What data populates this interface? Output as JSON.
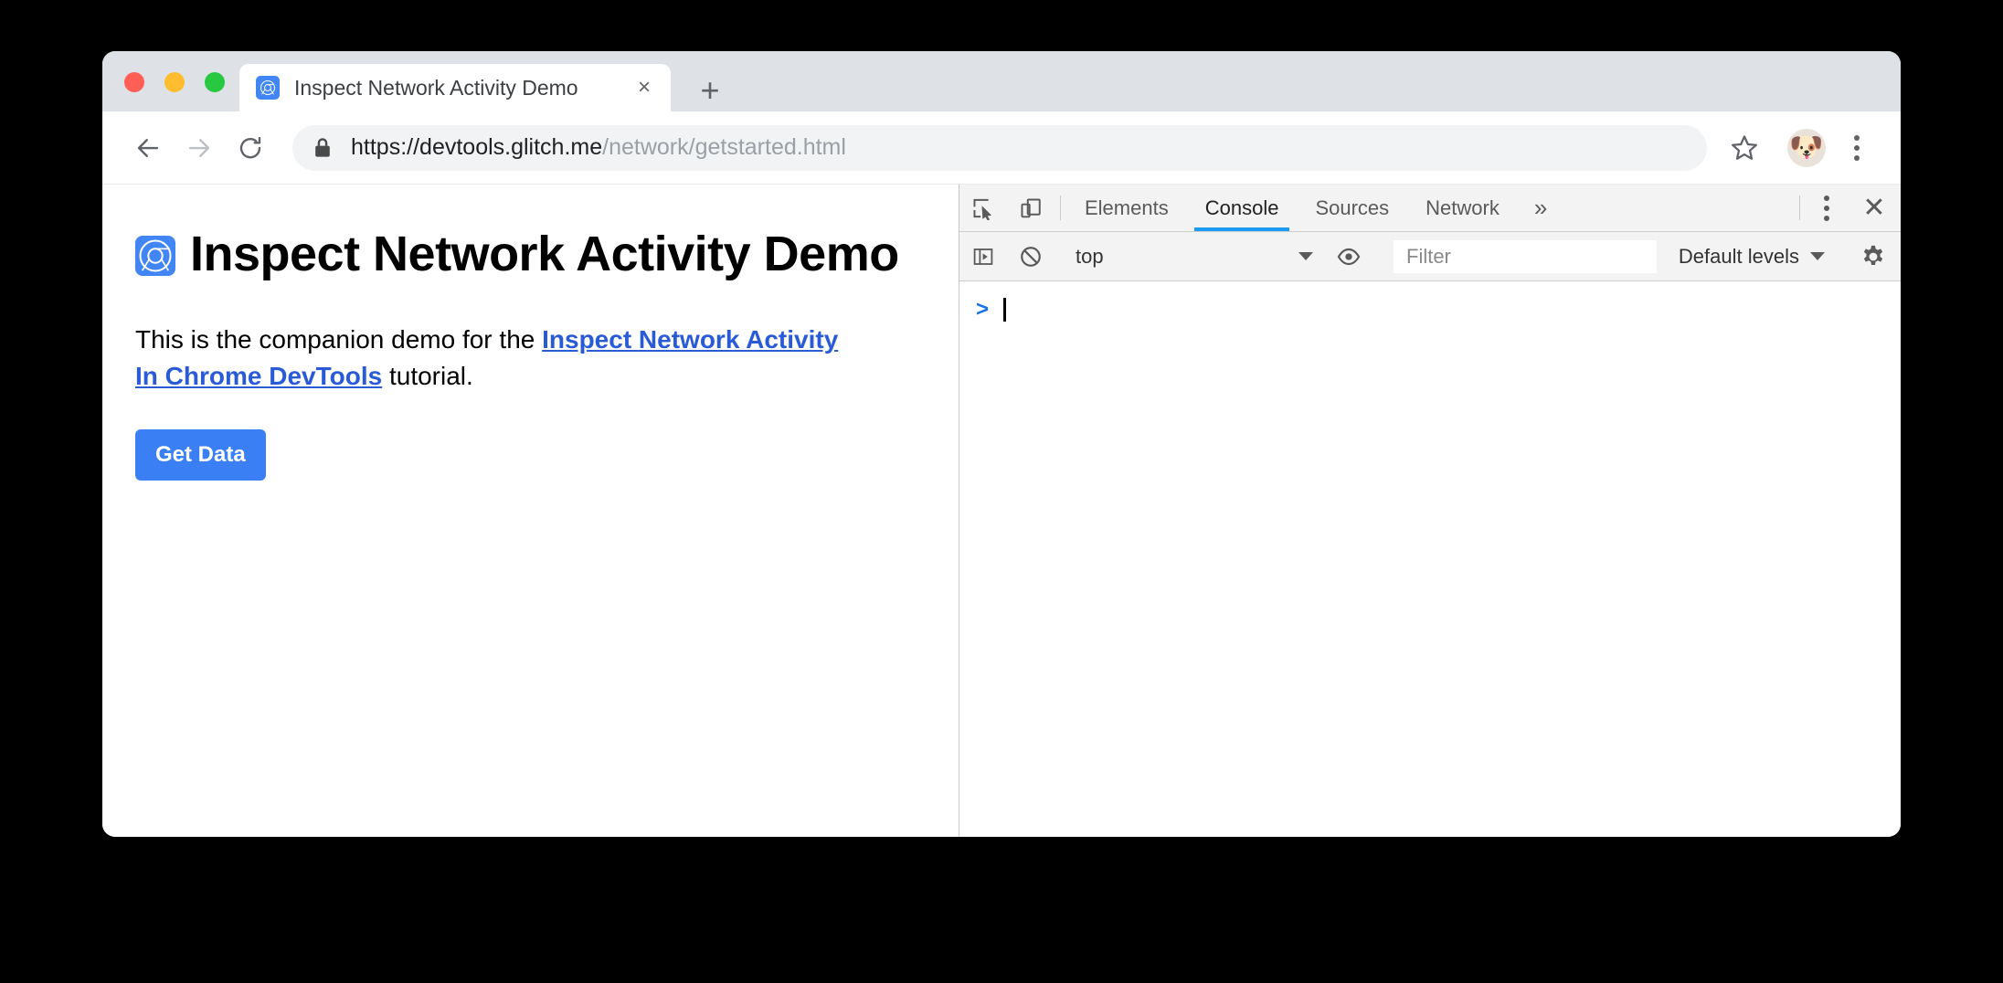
{
  "window": {
    "traffic_lights": [
      {
        "name": "close",
        "color": "#ff5f56"
      },
      {
        "name": "minimize",
        "color": "#febc2e"
      },
      {
        "name": "maximize",
        "color": "#28c840"
      }
    ]
  },
  "tab_strip": {
    "active_tab": {
      "title": "Inspect Network Activity Demo",
      "favicon": "chrome-devtools-icon",
      "close_label": "×"
    },
    "new_tab_label": "+"
  },
  "nav_toolbar": {
    "back_icon": "arrow-left-icon",
    "forward_icon": "arrow-right-icon",
    "reload_icon": "reload-icon",
    "lock_icon": "lock-icon",
    "url_origin": "https://devtools.glitch.me",
    "url_path": "/network/getstarted.html",
    "bookmark_icon": "star-outline-icon",
    "avatar_glyph": "🐶",
    "menu_icon": "three-dot-vertical-icon"
  },
  "page": {
    "heading": "Inspect Network Activity Demo",
    "heading_icon": "chrome-devtools-icon",
    "paragraph_before": "This is the companion demo for the ",
    "paragraph_link": "Inspect Network Activity In Chrome DevTools",
    "paragraph_after": " tutorial.",
    "get_data_button": "Get Data",
    "accent_color": "#3b7ff5",
    "link_color": "#2a5bd7"
  },
  "devtools": {
    "inspect_icon": "inspect-element-icon",
    "device_toolbar_icon": "device-toolbar-icon",
    "tabs": [
      {
        "label": "Elements",
        "active": false
      },
      {
        "label": "Console",
        "active": true
      },
      {
        "label": "Sources",
        "active": false
      },
      {
        "label": "Network",
        "active": false
      }
    ],
    "more_tabs_label": "»",
    "menu_icon": "three-dot-vertical-icon",
    "close_label": "✕",
    "active_tab_underline_color": "#1a9af5",
    "console_toolbar": {
      "sidebar_toggle_icon": "console-sidebar-icon",
      "clear_console_icon": "clear-console-icon",
      "context_value": "top",
      "live_expression_icon": "eye-icon",
      "filter_placeholder": "Filter",
      "filter_value": "",
      "levels_value": "Default levels",
      "settings_icon": "gear-icon"
    },
    "console_body": {
      "prompt_symbol": ">",
      "prompt_value": ""
    }
  }
}
